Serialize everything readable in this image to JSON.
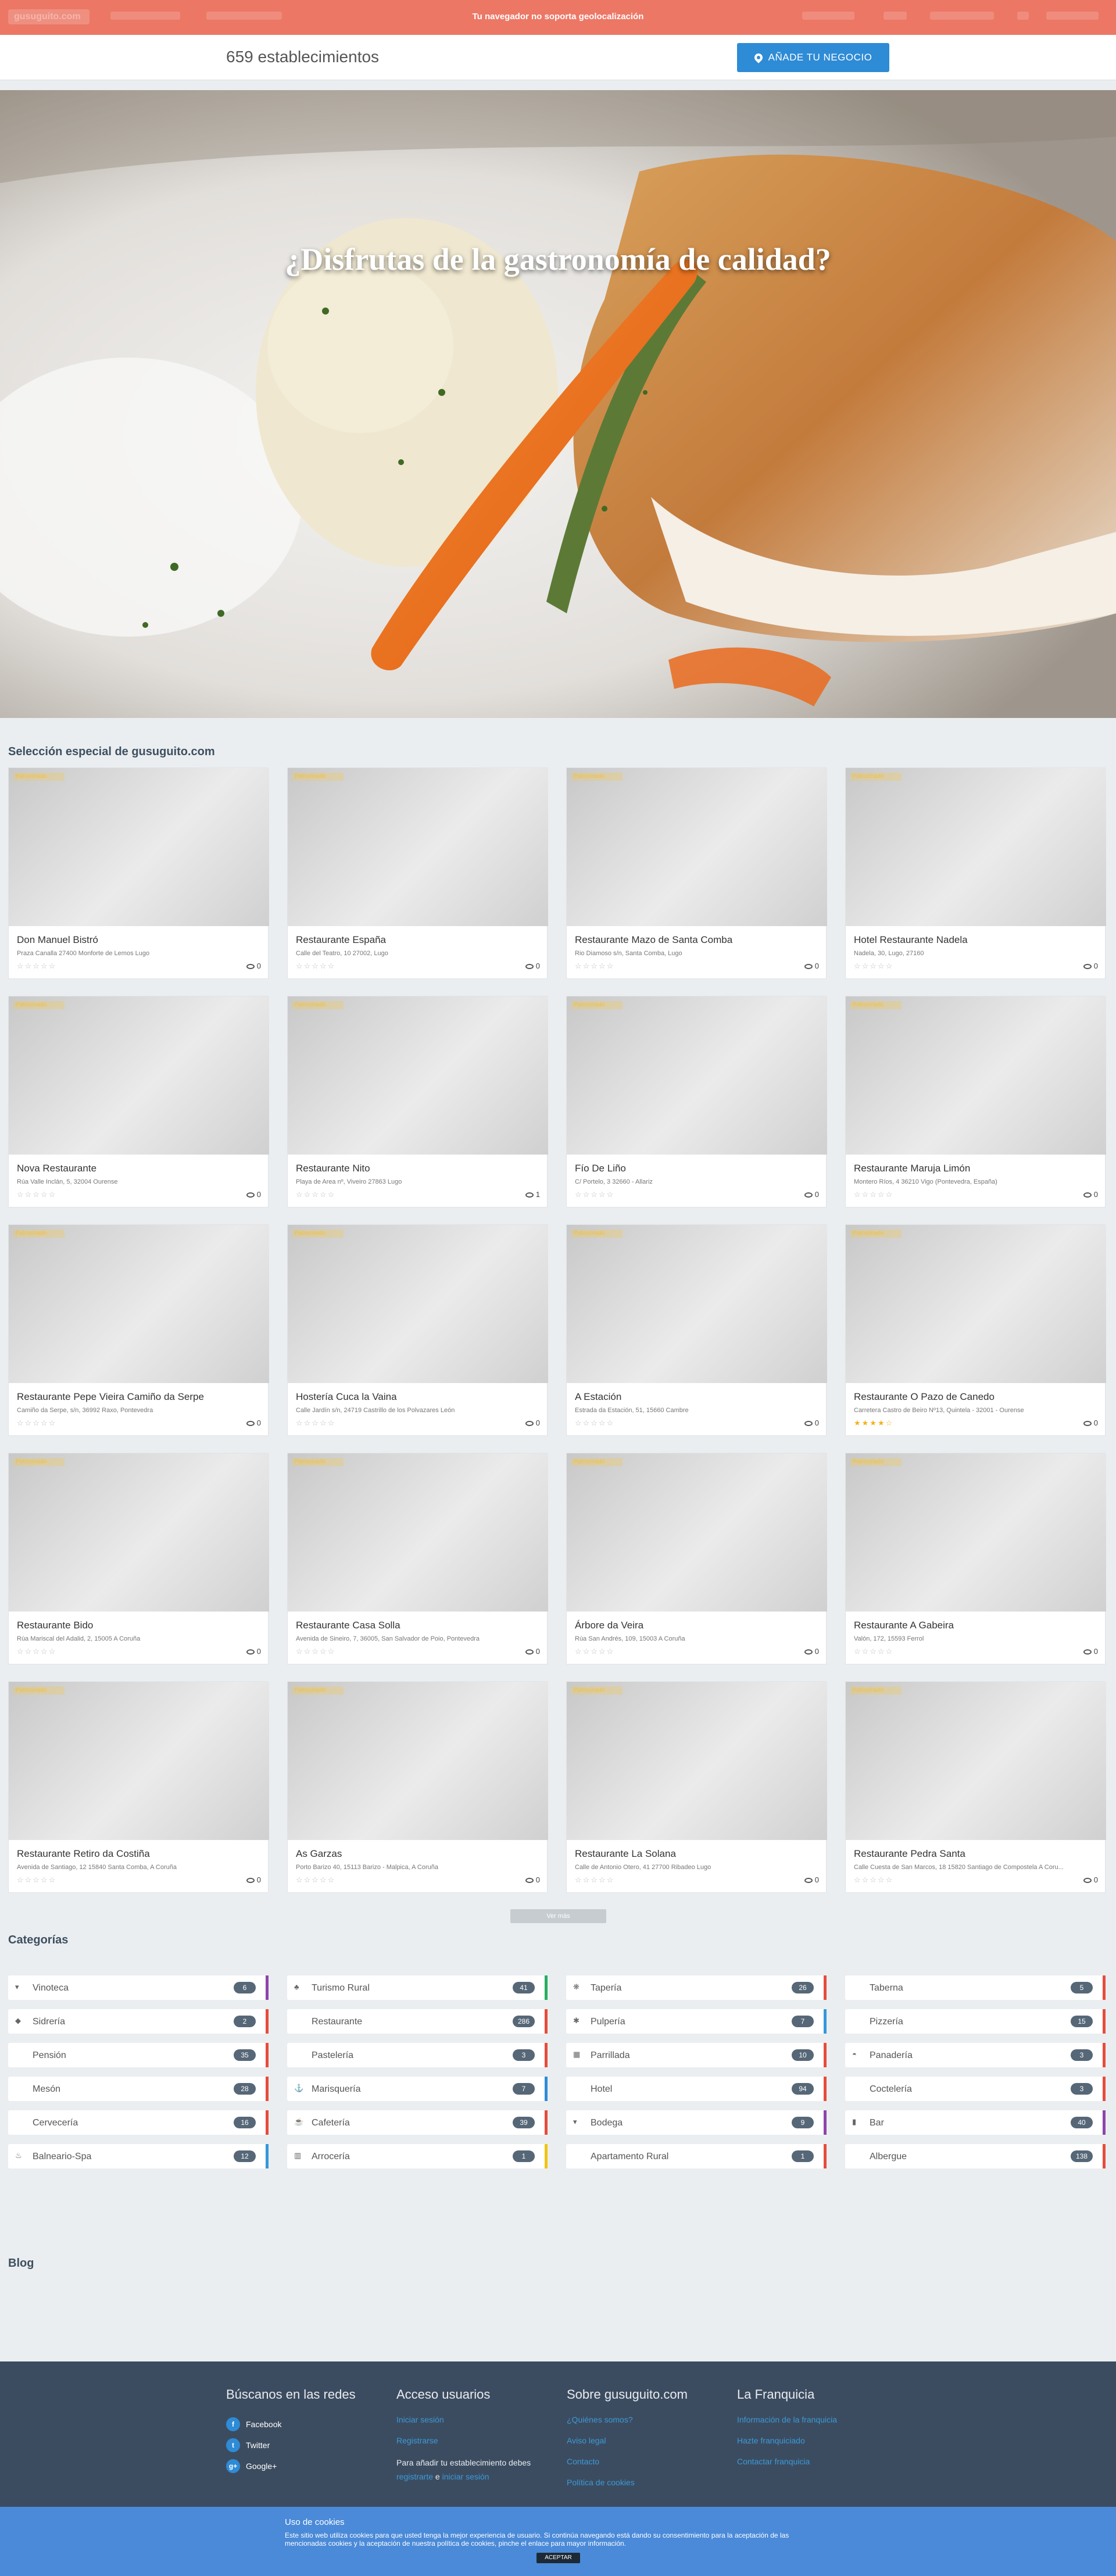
{
  "topbar": {
    "logo": "gusuguito.com",
    "geo_message": "Tu navegador no soporta geolocalización"
  },
  "counter": {
    "count_text": "659 establecimientos",
    "add_button": "AÑADE TU NEGOCIO"
  },
  "hero": {
    "title": "¿Disfrutas de la gastronomía de calidad?"
  },
  "featured": {
    "title": "Selección especial de gusuguito.com",
    "badge": "Patrocinado",
    "cards": [
      {
        "name": "Don Manuel Bistró",
        "address": "Praza Canalla 27400 Monforte de Lemos Lugo",
        "stars": "☆☆☆☆☆",
        "rated": false,
        "views": "0"
      },
      {
        "name": "Restaurante España",
        "address": "Calle del Teatro, 10 27002, Lugo",
        "stars": "☆☆☆☆☆",
        "rated": false,
        "views": "0"
      },
      {
        "name": "Restaurante Mazo de Santa Comba",
        "address": "Rio Diamoso s/n, Santa Comba, Lugo",
        "stars": "☆☆☆☆☆",
        "rated": false,
        "views": "0"
      },
      {
        "name": "Hotel Restaurante Nadela",
        "address": "Nadela, 30, Lugo, 27160",
        "stars": "☆☆☆☆☆",
        "rated": false,
        "views": "0"
      },
      {
        "name": "Nova Restaurante",
        "address": "Rúa Valle Inclán, 5, 32004 Ourense",
        "stars": "☆☆☆☆☆",
        "rated": false,
        "views": "0"
      },
      {
        "name": "Restaurante Nito",
        "address": "Playa de Area nº, Viveiro 27863 Lugo",
        "stars": "☆☆☆☆☆",
        "rated": false,
        "views": "1"
      },
      {
        "name": "Fío De Liño",
        "address": "C/ Portelo, 3 32660 - Allariz",
        "stars": "☆☆☆☆☆",
        "rated": false,
        "views": "0"
      },
      {
        "name": "Restaurante Maruja Limón",
        "address": "Montero Ríos, 4 36210 Vigo (Pontevedra, España)",
        "stars": "☆☆☆☆☆",
        "rated": false,
        "views": "0"
      },
      {
        "name": "Restaurante Pepe Vieira Camiño da Serpe",
        "address": "Camiño da Serpe, s/n, 36992 Raxo, Pontevedra",
        "stars": "☆☆☆☆☆",
        "rated": false,
        "views": "0"
      },
      {
        "name": "Hostería Cuca la Vaina",
        "address": "Calle Jardín s/n, 24719 Castrillo de los Polvazares León",
        "stars": "☆☆☆☆☆",
        "rated": false,
        "views": "0"
      },
      {
        "name": "A Estación",
        "address": "Estrada da Estación, 51, 15660 Cambre",
        "stars": "☆☆☆☆☆",
        "rated": false,
        "views": "0"
      },
      {
        "name": "Restaurante O Pazo de Canedo",
        "address": "Carretera Castro de Beiro Nº13, Quintela - 32001 - Ourense",
        "stars": "★★★★☆",
        "rated": true,
        "views": "0"
      },
      {
        "name": "Restaurante Bido",
        "address": "Rúa Mariscal del Adalid, 2, 15005 A Coruña",
        "stars": "☆☆☆☆☆",
        "rated": false,
        "views": "0"
      },
      {
        "name": "Restaurante Casa Solla",
        "address": "Avenida de Sineiro, 7, 36005, San Salvador de Poio, Pontevedra",
        "stars": "☆☆☆☆☆",
        "rated": false,
        "views": "0"
      },
      {
        "name": "Árbore da Veira",
        "address": "Rúa San Andrés, 109, 15003 A Coruña",
        "stars": "☆☆☆☆☆",
        "rated": false,
        "views": "0"
      },
      {
        "name": "Restaurante A Gabeira",
        "address": "Valón, 172, 15593 Ferrol",
        "stars": "☆☆☆☆☆",
        "rated": false,
        "views": "0"
      },
      {
        "name": "Restaurante Retiro da Costiña",
        "address": "Avenida de Santiago, 12 15840 Santa Comba, A Coruña",
        "stars": "☆☆☆☆☆",
        "rated": false,
        "views": "0"
      },
      {
        "name": "As Garzas",
        "address": "Porto Barizo 40, 15113 Barizo - Malpica, A Coruña",
        "stars": "☆☆☆☆☆",
        "rated": false,
        "views": "0"
      },
      {
        "name": "Restaurante La Solana",
        "address": "Calle de Antonio Otero, 41 27700 Ribadeo Lugo",
        "stars": "☆☆☆☆☆",
        "rated": false,
        "views": "0"
      },
      {
        "name": "Restaurante Pedra Santa",
        "address": "Calle Cuesta de San Marcos, 18 15820 Santiago de Compostela A Coru...",
        "stars": "☆☆☆☆☆",
        "rated": false,
        "views": "0"
      }
    ],
    "more_button": "Ver más"
  },
  "categories": {
    "title": "Categorías",
    "items": [
      {
        "label": "Vinoteca",
        "count": "6",
        "icon": "glass-icon",
        "color": "#8e44ad"
      },
      {
        "label": "Turismo Rural",
        "count": "41",
        "icon": "tree-icon",
        "color": "#27ae60"
      },
      {
        "label": "Tapería",
        "count": "26",
        "icon": "tapas-icon",
        "color": "#e74c3c"
      },
      {
        "label": "Taberna",
        "count": "5",
        "icon": "",
        "color": "#e74c3c"
      },
      {
        "label": "Sidrería",
        "count": "2",
        "icon": "cider-icon",
        "color": "#e74c3c"
      },
      {
        "label": "Restaurante",
        "count": "286",
        "icon": "",
        "color": "#e74c3c"
      },
      {
        "label": "Pulpería",
        "count": "7",
        "icon": "octopus-icon",
        "color": "#3498db"
      },
      {
        "label": "Pizzería",
        "count": "15",
        "icon": "",
        "color": "#e74c3c"
      },
      {
        "label": "Pensión",
        "count": "35",
        "icon": "",
        "color": "#e74c3c"
      },
      {
        "label": "Pastelería",
        "count": "3",
        "icon": "",
        "color": "#e74c3c"
      },
      {
        "label": "Parrillada",
        "count": "10",
        "icon": "grill-icon",
        "color": "#e74c3c"
      },
      {
        "label": "Panadería",
        "count": "3",
        "icon": "bread-icon",
        "color": "#e74c3c"
      },
      {
        "label": "Mesón",
        "count": "28",
        "icon": "",
        "color": "#e74c3c"
      },
      {
        "label": "Marisquería",
        "count": "7",
        "icon": "anchor-icon",
        "color": "#2e8bd6"
      },
      {
        "label": "Hotel",
        "count": "94",
        "icon": "",
        "color": "#e74c3c"
      },
      {
        "label": "Coctelería",
        "count": "3",
        "icon": "",
        "color": "#e74c3c"
      },
      {
        "label": "Cervecería",
        "count": "16",
        "icon": "",
        "color": "#e74c3c"
      },
      {
        "label": "Cafetería",
        "count": "39",
        "icon": "coffee-icon",
        "color": "#e74c3c"
      },
      {
        "label": "Bodega",
        "count": "9",
        "icon": "glass-icon",
        "color": "#8e44ad"
      },
      {
        "label": "Bar",
        "count": "40",
        "icon": "beer-icon",
        "color": "#8e44ad"
      },
      {
        "label": "Balneario-Spa",
        "count": "12",
        "icon": "spa-icon",
        "color": "#3498db"
      },
      {
        "label": "Arrocería",
        "count": "1",
        "icon": "rice-icon",
        "color": "#f1c40f"
      },
      {
        "label": "Apartamento Rural",
        "count": "1",
        "icon": "",
        "color": "#e74c3c"
      },
      {
        "label": "Albergue",
        "count": "138",
        "icon": "",
        "color": "#e74c3c"
      }
    ]
  },
  "blog": {
    "title": "Blog"
  },
  "footer": {
    "social": {
      "title": "Búscanos en las redes",
      "items": [
        "Facebook",
        "Twitter",
        "Google+"
      ]
    },
    "users": {
      "title": "Acceso usuarios",
      "links": [
        "Iniciar sesión",
        "Registrarse"
      ],
      "note_prefix": "Para añadir tu establecimiento debes ",
      "note_link1": "registrarte",
      "note_mid": " e ",
      "note_link2": "iniciar sesión"
    },
    "about": {
      "title": "Sobre gusuguito.com",
      "links": [
        "¿Quiénes somos?",
        "Aviso legal",
        "Contacto",
        "Política de cookies"
      ]
    },
    "franchise": {
      "title": "La Franquicia",
      "links": [
        "Información de la franquicia",
        "Hazte franquiciado",
        "Contactar franquicia"
      ]
    }
  },
  "cookie": {
    "title": "Uso de cookies",
    "text": "Este sitio web utiliza cookies para que usted tenga la mejor experiencia de usuario. Si continúa navegando está dando su consentimiento para la aceptación de las mencionadas cookies y la aceptación de nuestra política de cookies, pinche el enlace para mayor información.",
    "accept": "ACEPTAR"
  }
}
